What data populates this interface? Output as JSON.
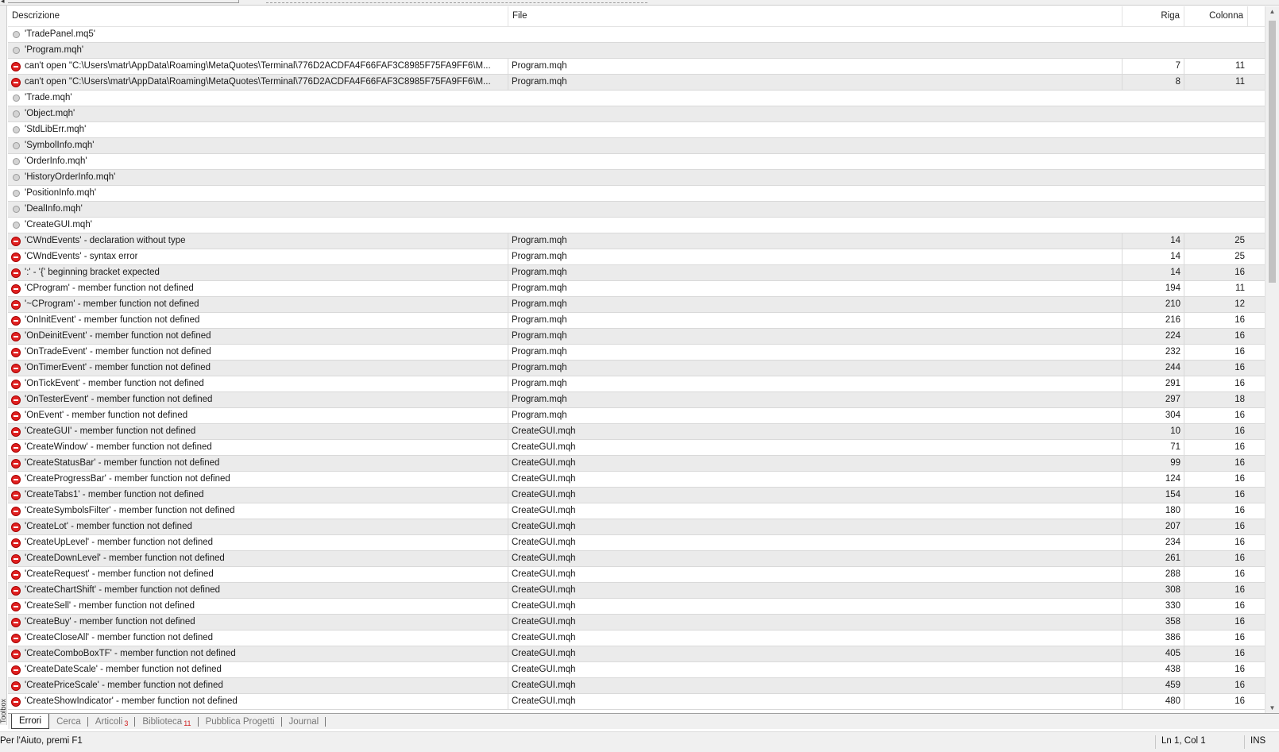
{
  "left_rail_label": "Toolbox",
  "columns": {
    "description": "Descrizione",
    "file": "File",
    "line": "Riga",
    "column": "Colonna"
  },
  "rows": [
    {
      "type": "info",
      "description": "'TradePanel.mq5'",
      "file": "",
      "line": "",
      "column": ""
    },
    {
      "type": "info",
      "description": "'Program.mqh'",
      "file": "",
      "line": "",
      "column": ""
    },
    {
      "type": "error",
      "description": "can't open \"C:\\Users\\matr\\AppData\\Roaming\\MetaQuotes\\Terminal\\776D2ACDFA4F66FAF3C8985F75FA9FF6\\M...",
      "file": "Program.mqh",
      "line": "7",
      "column": "11"
    },
    {
      "type": "error",
      "description": "can't open \"C:\\Users\\matr\\AppData\\Roaming\\MetaQuotes\\Terminal\\776D2ACDFA4F66FAF3C8985F75FA9FF6\\M...",
      "file": "Program.mqh",
      "line": "8",
      "column": "11"
    },
    {
      "type": "info",
      "description": "'Trade.mqh'",
      "file": "",
      "line": "",
      "column": ""
    },
    {
      "type": "info",
      "description": "'Object.mqh'",
      "file": "",
      "line": "",
      "column": ""
    },
    {
      "type": "info",
      "description": "'StdLibErr.mqh'",
      "file": "",
      "line": "",
      "column": ""
    },
    {
      "type": "info",
      "description": "'SymbolInfo.mqh'",
      "file": "",
      "line": "",
      "column": ""
    },
    {
      "type": "info",
      "description": "'OrderInfo.mqh'",
      "file": "",
      "line": "",
      "column": ""
    },
    {
      "type": "info",
      "description": "'HistoryOrderInfo.mqh'",
      "file": "",
      "line": "",
      "column": ""
    },
    {
      "type": "info",
      "description": "'PositionInfo.mqh'",
      "file": "",
      "line": "",
      "column": ""
    },
    {
      "type": "info",
      "description": "'DealInfo.mqh'",
      "file": "",
      "line": "",
      "column": ""
    },
    {
      "type": "info",
      "description": "'CreateGUI.mqh'",
      "file": "",
      "line": "",
      "column": ""
    },
    {
      "type": "error",
      "description": "'CWndEvents' - declaration without type",
      "file": "Program.mqh",
      "line": "14",
      "column": "25"
    },
    {
      "type": "error",
      "description": "'CWndEvents' - syntax error",
      "file": "Program.mqh",
      "line": "14",
      "column": "25"
    },
    {
      "type": "error",
      "description": "':' - '{' beginning bracket expected",
      "file": "Program.mqh",
      "line": "14",
      "column": "16"
    },
    {
      "type": "error",
      "description": "'CProgram' - member function not defined",
      "file": "Program.mqh",
      "line": "194",
      "column": "11"
    },
    {
      "type": "error",
      "description": "'~CProgram' - member function not defined",
      "file": "Program.mqh",
      "line": "210",
      "column": "12"
    },
    {
      "type": "error",
      "description": "'OnInitEvent' - member function not defined",
      "file": "Program.mqh",
      "line": "216",
      "column": "16"
    },
    {
      "type": "error",
      "description": "'OnDeinitEvent' - member function not defined",
      "file": "Program.mqh",
      "line": "224",
      "column": "16"
    },
    {
      "type": "error",
      "description": "'OnTradeEvent' - member function not defined",
      "file": "Program.mqh",
      "line": "232",
      "column": "16"
    },
    {
      "type": "error",
      "description": "'OnTimerEvent' - member function not defined",
      "file": "Program.mqh",
      "line": "244",
      "column": "16"
    },
    {
      "type": "error",
      "description": "'OnTickEvent' - member function not defined",
      "file": "Program.mqh",
      "line": "291",
      "column": "16"
    },
    {
      "type": "error",
      "description": "'OnTesterEvent' - member function not defined",
      "file": "Program.mqh",
      "line": "297",
      "column": "18"
    },
    {
      "type": "error",
      "description": "'OnEvent' - member function not defined",
      "file": "Program.mqh",
      "line": "304",
      "column": "16"
    },
    {
      "type": "error",
      "description": "'CreateGUI' - member function not defined",
      "file": "CreateGUI.mqh",
      "line": "10",
      "column": "16"
    },
    {
      "type": "error",
      "description": "'CreateWindow' - member function not defined",
      "file": "CreateGUI.mqh",
      "line": "71",
      "column": "16"
    },
    {
      "type": "error",
      "description": "'CreateStatusBar' - member function not defined",
      "file": "CreateGUI.mqh",
      "line": "99",
      "column": "16"
    },
    {
      "type": "error",
      "description": "'CreateProgressBar' - member function not defined",
      "file": "CreateGUI.mqh",
      "line": "124",
      "column": "16"
    },
    {
      "type": "error",
      "description": "'CreateTabs1' - member function not defined",
      "file": "CreateGUI.mqh",
      "line": "154",
      "column": "16"
    },
    {
      "type": "error",
      "description": "'CreateSymbolsFilter' - member function not defined",
      "file": "CreateGUI.mqh",
      "line": "180",
      "column": "16"
    },
    {
      "type": "error",
      "description": "'CreateLot' - member function not defined",
      "file": "CreateGUI.mqh",
      "line": "207",
      "column": "16"
    },
    {
      "type": "error",
      "description": "'CreateUpLevel' - member function not defined",
      "file": "CreateGUI.mqh",
      "line": "234",
      "column": "16"
    },
    {
      "type": "error",
      "description": "'CreateDownLevel' - member function not defined",
      "file": "CreateGUI.mqh",
      "line": "261",
      "column": "16"
    },
    {
      "type": "error",
      "description": "'CreateRequest' - member function not defined",
      "file": "CreateGUI.mqh",
      "line": "288",
      "column": "16"
    },
    {
      "type": "error",
      "description": "'CreateChartShift' - member function not defined",
      "file": "CreateGUI.mqh",
      "line": "308",
      "column": "16"
    },
    {
      "type": "error",
      "description": "'CreateSell' - member function not defined",
      "file": "CreateGUI.mqh",
      "line": "330",
      "column": "16"
    },
    {
      "type": "error",
      "description": "'CreateBuy' - member function not defined",
      "file": "CreateGUI.mqh",
      "line": "358",
      "column": "16"
    },
    {
      "type": "error",
      "description": "'CreateCloseAll' - member function not defined",
      "file": "CreateGUI.mqh",
      "line": "386",
      "column": "16"
    },
    {
      "type": "error",
      "description": "'CreateComboBoxTF' - member function not defined",
      "file": "CreateGUI.mqh",
      "line": "405",
      "column": "16"
    },
    {
      "type": "error",
      "description": "'CreateDateScale' - member function not defined",
      "file": "CreateGUI.mqh",
      "line": "438",
      "column": "16"
    },
    {
      "type": "error",
      "description": "'CreatePriceScale' - member function not defined",
      "file": "CreateGUI.mqh",
      "line": "459",
      "column": "16"
    },
    {
      "type": "error",
      "description": "'CreateShowIndicator' - member function not defined",
      "file": "CreateGUI.mqh",
      "line": "480",
      "column": "16"
    }
  ],
  "tabs": [
    {
      "label": "Errori",
      "count": "",
      "active": true
    },
    {
      "label": "Cerca",
      "count": "",
      "active": false
    },
    {
      "label": "Articoli",
      "count": "3",
      "active": false
    },
    {
      "label": "Biblioteca",
      "count": "11",
      "active": false
    },
    {
      "label": "Pubblica Progetti",
      "count": "",
      "active": false
    },
    {
      "label": "Journal",
      "count": "",
      "active": false
    }
  ],
  "status": {
    "help_text": "Per l'Aiuto, premi F1",
    "position": "Ln 1, Col 1",
    "mode": "INS"
  },
  "icons": {
    "error": "error-circle-icon",
    "info": "info-dot-icon"
  },
  "colors": {
    "error_icon": "#e02020",
    "alt_row": "#ebebeb",
    "tab_count": "#d02020"
  }
}
